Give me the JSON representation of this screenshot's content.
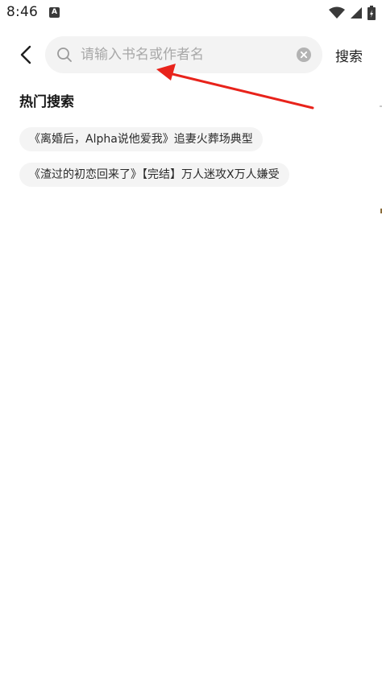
{
  "status_bar": {
    "time": "8:46",
    "app_indicator": "A"
  },
  "header": {
    "back_icon": "chevron-left-icon",
    "search": {
      "placeholder": "请输入书名或作者名",
      "value": ""
    },
    "search_button_label": "搜索"
  },
  "hot_search": {
    "title": "热门搜索",
    "items": [
      {
        "label": "《离婚后，Alpha说他爱我》追妻火葬场典型"
      },
      {
        "label": "《渣过的初恋回来了》【完结】万人迷攻X万人嫌受"
      }
    ]
  },
  "colors": {
    "background": "#ffffff",
    "search_bg": "#f3f3f3",
    "tag_bg": "#f4f4f4",
    "placeholder": "#a8a8a8",
    "annotation": "#e8231b"
  }
}
